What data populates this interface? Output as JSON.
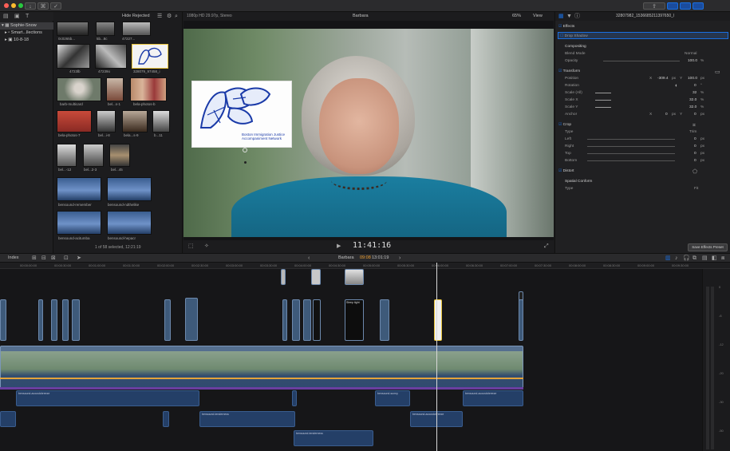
{
  "window": {
    "title_bar_icons": [
      "download-icon",
      "key-icon",
      "check-icon"
    ]
  },
  "library": {
    "items": [
      {
        "label": "Sophie-Snow",
        "icon": "library-icon",
        "selected": true
      },
      {
        "label": "Smart...llections",
        "icon": "folder-icon"
      },
      {
        "label": "10-8-18",
        "icon": "event-icon"
      }
    ]
  },
  "browser": {
    "filter": "Hide Rejected",
    "status": "1 of 58 selected, 12:21:19",
    "clips": [
      {
        "caption": "0c0265b..."
      },
      {
        "caption": "5b...8c"
      },
      {
        "caption": "47227..."
      },
      {
        "caption": "4723lb"
      },
      {
        "caption": "47239o"
      },
      {
        "caption": "328079_97458_i"
      },
      {
        "caption": "barb-multicard"
      },
      {
        "caption": "bel...s-1"
      },
      {
        "caption": "bela-photos-b"
      },
      {
        "caption": "bela-photos-7"
      },
      {
        "caption": "bel...i-8"
      },
      {
        "caption": "bela...s-9"
      },
      {
        "caption": "b...11"
      },
      {
        "caption": "bel...-12"
      },
      {
        "caption": "bel...2-3"
      },
      {
        "caption": "bel...45"
      },
      {
        "caption": "bensound-remember"
      },
      {
        "caption": "bensound-ndthelike"
      },
      {
        "caption": "bensound-acitumba"
      },
      {
        "caption": "bensound-hepacr"
      }
    ]
  },
  "viewer": {
    "format": "1080p HD 29.97p, Stereo",
    "title": "Barbara",
    "zoom": "65%",
    "view_label": "View",
    "timecode": "11:41:16",
    "logo_lines": [
      "Boston Immigration Justice",
      "Accompaniment Network"
    ]
  },
  "inspector": {
    "clip_name": "32807982_1536685211397650_l",
    "effects": "Effects",
    "drop_shadow": "Drop Shadow",
    "compositing": "Compositing",
    "blend_mode_label": "Blend Mode",
    "blend_mode_value": "Normal",
    "opacity_label": "Opacity",
    "opacity_value": "100.0",
    "transform": "Transform",
    "position_label": "Position",
    "position_x_label": "X",
    "position_x": "-309.4",
    "position_y_label": "Y",
    "position_y": "100.0",
    "rotation_label": "Rotation",
    "rotation_value": "0",
    "scale_all_label": "Scale (All)",
    "scale_all": "32",
    "scale_x_label": "Scale X",
    "scale_x": "32.0",
    "scale_y_label": "Scale Y",
    "scale_y": "32.0",
    "anchor_label": "Anchor",
    "anchor_x_label": "X",
    "anchor_x": "0",
    "anchor_y_label": "Y",
    "anchor_y": "0",
    "crop": "Crop",
    "crop_type_label": "Type",
    "crop_type": "Trim",
    "left_label": "Left",
    "left_value": "0",
    "right_label": "Right",
    "right_value": "0",
    "top_label": "Top",
    "top_value": "0",
    "bottom_label": "Bottom",
    "bottom_value": "0",
    "distort": "Distort",
    "spatial_conform": "Spatial Conform",
    "sc_type_label": "Type",
    "sc_type": "Fit",
    "save_preset": "Save Effects Preset",
    "unit_px": "px",
    "unit_pct": "%",
    "unit_deg": "°"
  },
  "timeline": {
    "index_label": "Index",
    "project": "Barbara",
    "position": "09:08",
    "duration": "13:01:19",
    "ruler_marks": [
      "00:00:00:00",
      "00:00:30:00",
      "00:01:00:00",
      "00:01:30:00",
      "00:02:00:00",
      "00:02:30:00",
      "00:03:00:00",
      "00:03:30:00",
      "00:04:00:00",
      "00:04:30:00",
      "00:05:00:00",
      "00:05:30:00",
      "00:06:00:00",
      "00:06:30:00",
      "00:07:00:00",
      "00:07:30:00",
      "00:08:00:00",
      "00:08:30:00",
      "00:09:00:00",
      "00:09:30:00"
    ],
    "audio_clips": [
      "bensound-acoustcbreeze",
      "bensound-sunny",
      "bensound-acoustcbreeze",
      "bensound-tenderness",
      "bensound-acoustcbreeze",
      "bensound-tenderness"
    ],
    "broll_label": "Sleep tight",
    "meter_marks": [
      "0",
      "-6",
      "-12",
      "-20",
      "-30",
      "-50"
    ]
  },
  "colors": {
    "accent": "#1a6fe0",
    "playhead": "#d9d9d9",
    "audio": "#243f67",
    "video": "#3e5a7a",
    "logo_blue": "#1a3aa8"
  }
}
